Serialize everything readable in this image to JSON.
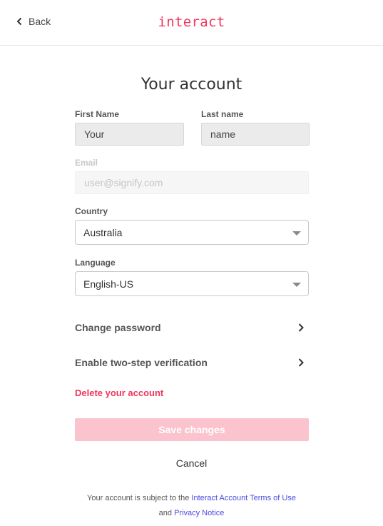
{
  "header": {
    "back_label": "Back",
    "logo_text": "interact"
  },
  "page": {
    "title": "Your account"
  },
  "form": {
    "first_name": {
      "label": "First Name",
      "value": "Your"
    },
    "last_name": {
      "label": "Last name",
      "value": "name"
    },
    "email": {
      "label": "Email",
      "value": "user@signify.com"
    },
    "country": {
      "label": "Country",
      "value": "Australia"
    },
    "language": {
      "label": "Language",
      "value": "English-US"
    }
  },
  "actions": {
    "change_password": "Change password",
    "two_step": "Enable two-step verification",
    "delete_account": "Delete your account",
    "save": "Save changes",
    "cancel": "Cancel"
  },
  "footer": {
    "prefix": "Your account is subject to the ",
    "terms_link": "Interact Account Terms of Use",
    "conjunction": "and ",
    "privacy_link": "Privacy Notice"
  },
  "colors": {
    "brand": "#f0365e",
    "save_disabled_bg": "#fbc3cd",
    "link": "#4a4ae0"
  }
}
